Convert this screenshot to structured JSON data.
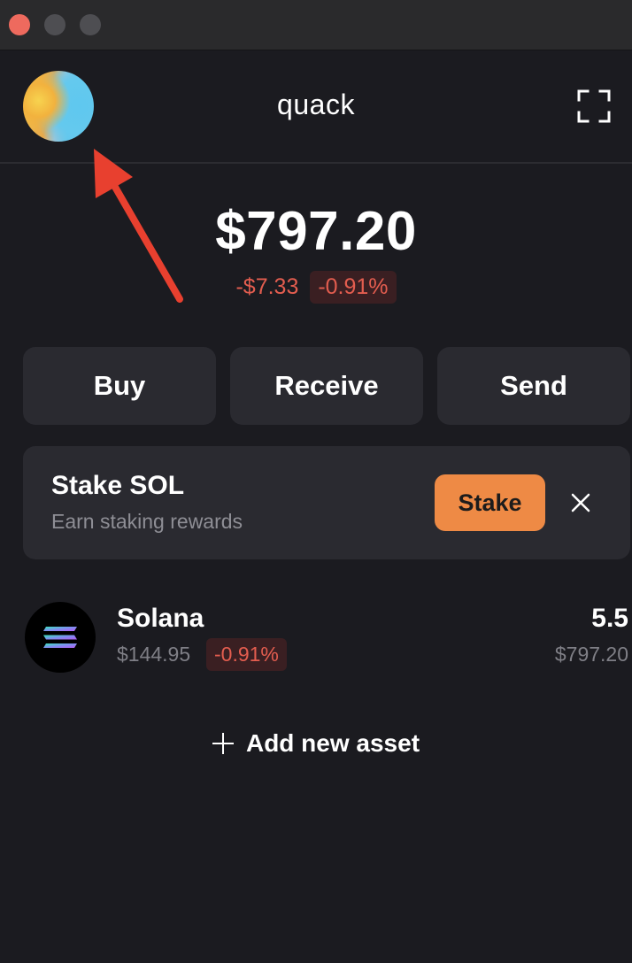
{
  "window": {
    "controls": [
      "close",
      "minimize",
      "maximize"
    ]
  },
  "header": {
    "wallet_name": "quack",
    "avatar_icon": "avatar-gradient",
    "expand_icon": "expand-icon"
  },
  "annotation": {
    "arrow_color": "#e8402f"
  },
  "portfolio": {
    "balance": "$797.20",
    "change_amount": "-$7.33",
    "change_percent": "-0.91%"
  },
  "actions": {
    "buy_label": "Buy",
    "receive_label": "Receive",
    "send_label": "Send"
  },
  "stake_banner": {
    "title": "Stake SOL",
    "subtitle": "Earn staking rewards",
    "button_label": "Stake",
    "button_color": "#ee8a45",
    "close_icon": "close-icon"
  },
  "assets": [
    {
      "name": "Solana",
      "price": "$144.95",
      "change_percent": "-0.91%",
      "amount": "5.5",
      "value": "$797.20",
      "icon": "solana-logo"
    }
  ],
  "add_asset": {
    "label": "Add new asset",
    "icon": "plus-icon"
  },
  "colors": {
    "background": "#1b1b20",
    "card": "#2a2a30",
    "negative": "#e35d4f",
    "accent": "#ee8a45"
  }
}
